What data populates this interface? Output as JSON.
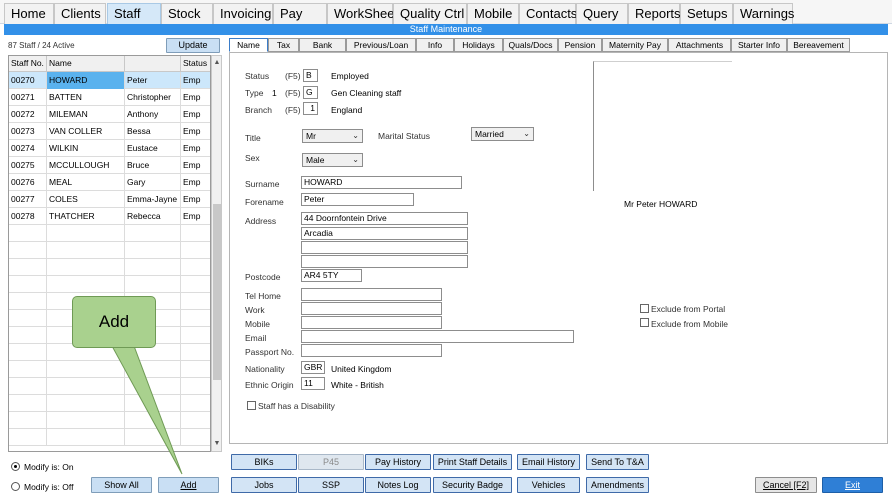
{
  "menu": {
    "tabs": [
      "Home",
      "Clients",
      "Staff",
      "Stock",
      "Invoicing",
      "Pay",
      "WorkSheet",
      "Quality Ctrl",
      "Mobile",
      "Contacts",
      "Query",
      "Reports",
      "Setups",
      "Warnings"
    ],
    "active": "Staff"
  },
  "window": {
    "title": "Staff Maintenance"
  },
  "staff_list": {
    "count_text": "87 Staff / 24 Active",
    "update_label": "Update",
    "columns": [
      "Staff No.",
      "Name",
      "",
      "Status"
    ],
    "rows": [
      [
        "00270",
        "HOWARD",
        "Peter",
        "Emp"
      ],
      [
        "00271",
        "BATTEN",
        "Christopher",
        "Emp"
      ],
      [
        "00272",
        "MILEMAN",
        "Anthony",
        "Emp"
      ],
      [
        "00273",
        "VAN COLLER",
        "Bessa",
        "Emp"
      ],
      [
        "00274",
        "WILKIN",
        "Eustace",
        "Emp"
      ],
      [
        "00275",
        "MCCULLOUGH",
        "Bruce",
        "Emp"
      ],
      [
        "00276",
        "MEAL",
        "Gary",
        "Emp"
      ],
      [
        "00277",
        "COLES",
        "Emma-Jayne",
        "Emp"
      ],
      [
        "00278",
        "THATCHER",
        "Rebecca",
        "Emp"
      ]
    ]
  },
  "tabs": [
    "Name",
    "Tax",
    "Bank",
    "Previous/Loan",
    "Info",
    "Holidays",
    "Quals/Docs",
    "Pension",
    "Maternity Pay",
    "Attachments",
    "Starter Info",
    "Bereavement"
  ],
  "form": {
    "status": {
      "label": "Status",
      "key": "(F5)",
      "code": "B",
      "text": "Employed"
    },
    "type": {
      "label": "Type",
      "num": "1",
      "key": "(F5)",
      "code": "G",
      "text": "Gen Cleaning staff"
    },
    "branch": {
      "label": "Branch",
      "key": "(F5)",
      "code": "1",
      "text": "England"
    },
    "title": {
      "label": "Title",
      "value": "Mr"
    },
    "marital": {
      "label": "Marital Status",
      "value": "Married"
    },
    "sex": {
      "label": "Sex",
      "value": "Male"
    },
    "surname": {
      "label": "Surname",
      "value": "HOWARD"
    },
    "forename": {
      "label": "Forename",
      "value": "Peter"
    },
    "address": {
      "label": "Address",
      "lines": [
        "44 Doornfontein Drive",
        "Arcadia",
        "",
        ""
      ]
    },
    "postcode": {
      "label": "Postcode",
      "value": "AR4 5TY"
    },
    "tel_home": {
      "label": "Tel Home",
      "value": ""
    },
    "work": {
      "label": "Work",
      "value": ""
    },
    "mobile": {
      "label": "Mobile",
      "value": ""
    },
    "email": {
      "label": "Email",
      "value": ""
    },
    "passport": {
      "label": "Passport No.",
      "value": ""
    },
    "nationality": {
      "label": "Nationality",
      "code": "GBR",
      "text": "United Kingdom"
    },
    "ethnic": {
      "label": "Ethnic Origin",
      "code": "11",
      "text": "White - British"
    },
    "disability": {
      "label": "Staff has a Disability",
      "checked": false
    },
    "display_name": "Mr Peter HOWARD",
    "exclude_portal": {
      "label": "Exclude from Portal",
      "checked": false
    },
    "exclude_mobile": {
      "label": "Exclude from Mobile",
      "checked": false
    }
  },
  "bottom": {
    "modify_on": "Modify is: On",
    "modify_off": "Modify is: Off",
    "show_all": "Show All",
    "add": "Add",
    "row1": [
      "BIKs",
      "P45",
      "Pay History",
      "Print Staff Details",
      "Email History",
      "Send To T&A"
    ],
    "row2": [
      "Jobs",
      "SSP",
      "Notes Log",
      "Security Badge",
      "Vehicles",
      "Amendments"
    ],
    "cancel": "Cancel [F2]",
    "exit": "Exit"
  },
  "callout": {
    "text": "Add"
  },
  "colors": {
    "accent": "#3290e8",
    "selected_row": "#cce7fb",
    "highlight_cell": "#5ab2ee",
    "callout": "#a9d18e"
  }
}
